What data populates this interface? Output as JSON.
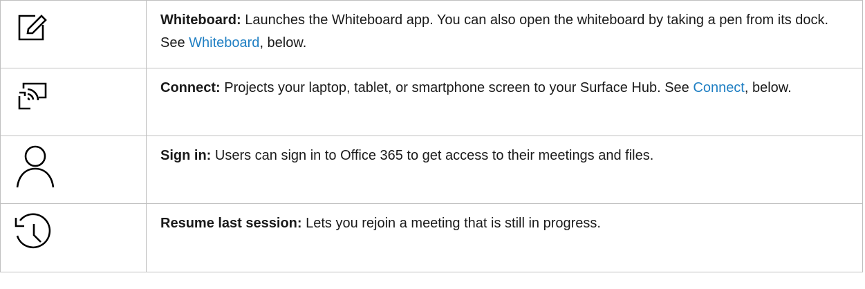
{
  "rows": [
    {
      "icon": "whiteboard-pen-icon",
      "label": "Whiteboard:",
      "text_before": " Launches the Whiteboard app. You can also open the whiteboard by taking a pen from its dock. See ",
      "link": "Whiteboard",
      "text_after": ", below."
    },
    {
      "icon": "cast-screen-icon",
      "label": "Connect:",
      "text_before": " Projects your laptop, tablet, or smartphone screen to your Surface Hub. See ",
      "link": "Connect",
      "text_after": ", below."
    },
    {
      "icon": "person-icon",
      "label": "Sign in:",
      "text": " Users can sign in to Office 365 to get access to their meetings and files."
    },
    {
      "icon": "history-clock-icon",
      "label": "Resume last session:",
      "text": " Lets you rejoin a meeting that is still in progress."
    }
  ],
  "colors": {
    "link": "#1f7fc3",
    "border": "#bfbfbf",
    "text": "#1a1a1a"
  }
}
